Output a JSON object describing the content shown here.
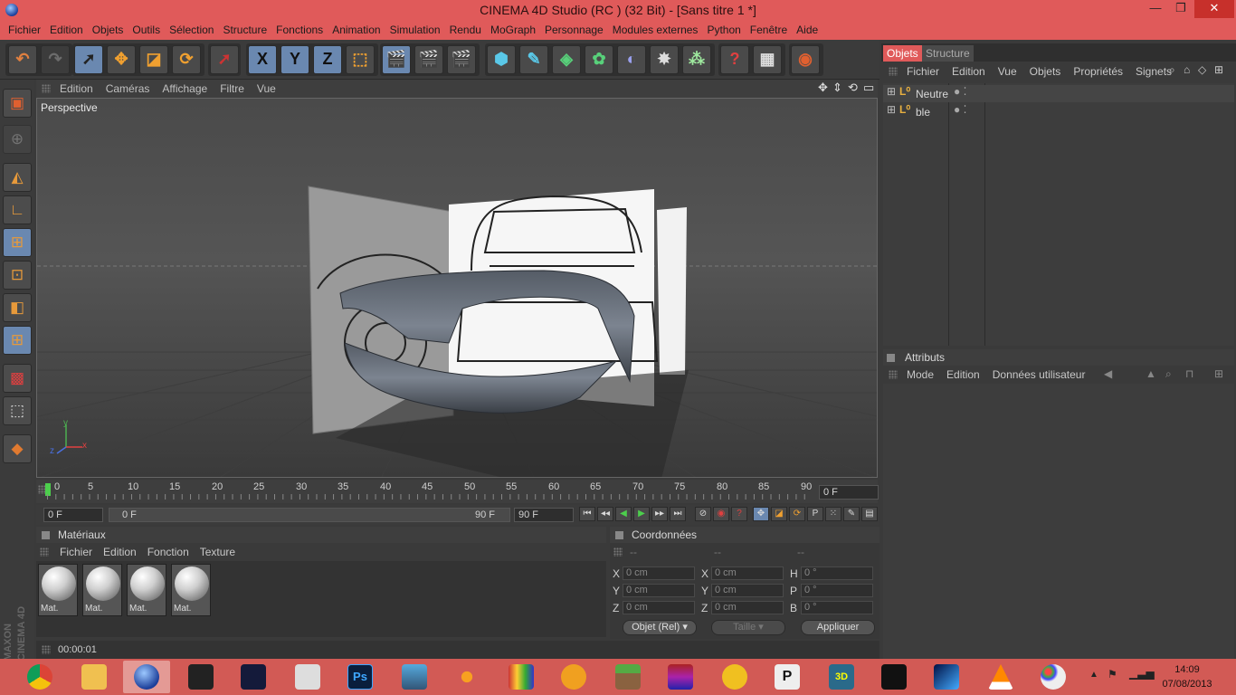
{
  "window": {
    "title": "CINEMA 4D Studio (RC ) (32 Bit) - [Sans titre 1 *]",
    "min_glyph": "—",
    "max_glyph": "❐",
    "close_glyph": "✕"
  },
  "menubar": [
    "Fichier",
    "Edition",
    "Objets",
    "Outils",
    "Sélection",
    "Structure",
    "Fonctions",
    "Animation",
    "Simulation",
    "Rendu",
    "MoGraph",
    "Personnage",
    "Modules externes",
    "Python",
    "Fenêtre",
    "Aide"
  ],
  "toolbar": {
    "axis_x": "X",
    "axis_y": "Y",
    "axis_z": "Z"
  },
  "viewport": {
    "menu": [
      "Edition",
      "Caméras",
      "Affichage",
      "Filtre",
      "Vue"
    ],
    "label": "Perspective",
    "axis_y": "y",
    "axis_x": "x",
    "axis_z": "z"
  },
  "timeline": {
    "ticks": [
      "0",
      "5",
      "10",
      "15",
      "20",
      "25",
      "30",
      "35",
      "40",
      "45",
      "50",
      "55",
      "60",
      "65",
      "70",
      "75",
      "80",
      "85",
      "90"
    ],
    "current": "0 F",
    "start": "0 F",
    "range_start": "0 F",
    "range_end": "90 F",
    "end": "90 F"
  },
  "materials": {
    "title": "Matériaux",
    "menu": [
      "Fichier",
      "Edition",
      "Fonction",
      "Texture"
    ],
    "items": [
      "Mat.",
      "Mat.",
      "Mat.",
      "Mat."
    ]
  },
  "coordinates": {
    "title": "Coordonnées",
    "col_headers": [
      "--",
      "--",
      "--"
    ],
    "rows": [
      {
        "l1": "X",
        "v1": "0 cm",
        "l2": "X",
        "v2": "0 cm",
        "l3": "H",
        "v3": "0 °"
      },
      {
        "l1": "Y",
        "v1": "0 cm",
        "l2": "Y",
        "v2": "0 cm",
        "l3": "P",
        "v3": "0 °"
      },
      {
        "l1": "Z",
        "v1": "0 cm",
        "l2": "Z",
        "v2": "0 cm",
        "l3": "B",
        "v3": "0 °"
      }
    ],
    "mode_select": "Objet (Rel)",
    "size_select": "Taille",
    "apply": "Appliquer"
  },
  "status": {
    "time": "00:00:01"
  },
  "objects_panel": {
    "tabs": [
      "Objets",
      "Structure"
    ],
    "menu": [
      "Fichier",
      "Edition",
      "Vue",
      "Objets",
      "Propriétés",
      "Signets"
    ],
    "items": [
      "Neutre",
      "ble"
    ]
  },
  "attributes_panel": {
    "title": "Attributs",
    "menu": [
      "Mode",
      "Edition",
      "Données utilisateur"
    ]
  },
  "branding": {
    "maxon": "MAXON",
    "cinema": "CINEMA 4D"
  },
  "taskbar": {
    "apps": [
      "chrome",
      "explorer",
      "cinema4d",
      "app-spiral",
      "app-x",
      "unity",
      "photoshop",
      "game-racing",
      "app-molecule",
      "winrar-colors",
      "audacity",
      "minecraft",
      "winrar",
      "app-yellow",
      "pixelmator",
      "3ds-max",
      "app-dark",
      "app-blue",
      "vlc",
      "paint"
    ],
    "time": "14:09",
    "date": "07/08/2013"
  },
  "colors": {
    "accent": "#e05a5a",
    "taskbar": "#d25a55",
    "selected_tool": "#6a88b0"
  }
}
